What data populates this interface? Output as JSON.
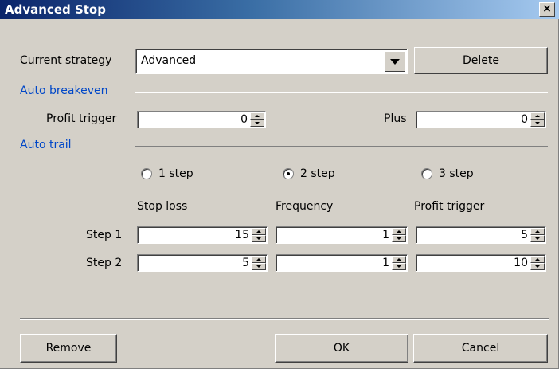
{
  "window": {
    "title": "Advanced Stop",
    "close_glyph": "×"
  },
  "strategy": {
    "label": "Current strategy",
    "value": "Advanced",
    "delete_label": "Delete"
  },
  "auto_breakeven": {
    "section_label": "Auto breakeven",
    "profit_trigger_label": "Profit trigger",
    "profit_trigger_value": "0",
    "plus_label": "Plus",
    "plus_value": "0"
  },
  "auto_trail": {
    "section_label": "Auto trail",
    "radios": [
      {
        "label": "1 step",
        "checked": false
      },
      {
        "label": "2 step",
        "checked": true
      },
      {
        "label": "3 step",
        "checked": false
      }
    ],
    "columns": [
      "Stop loss",
      "Frequency",
      "Profit trigger"
    ],
    "rows": [
      {
        "label": "Step 1",
        "values": [
          "15",
          "1",
          "5"
        ]
      },
      {
        "label": "Step 2",
        "values": [
          "5",
          "1",
          "10"
        ]
      }
    ]
  },
  "footer": {
    "remove_label": "Remove",
    "ok_label": "OK",
    "cancel_label": "Cancel"
  }
}
